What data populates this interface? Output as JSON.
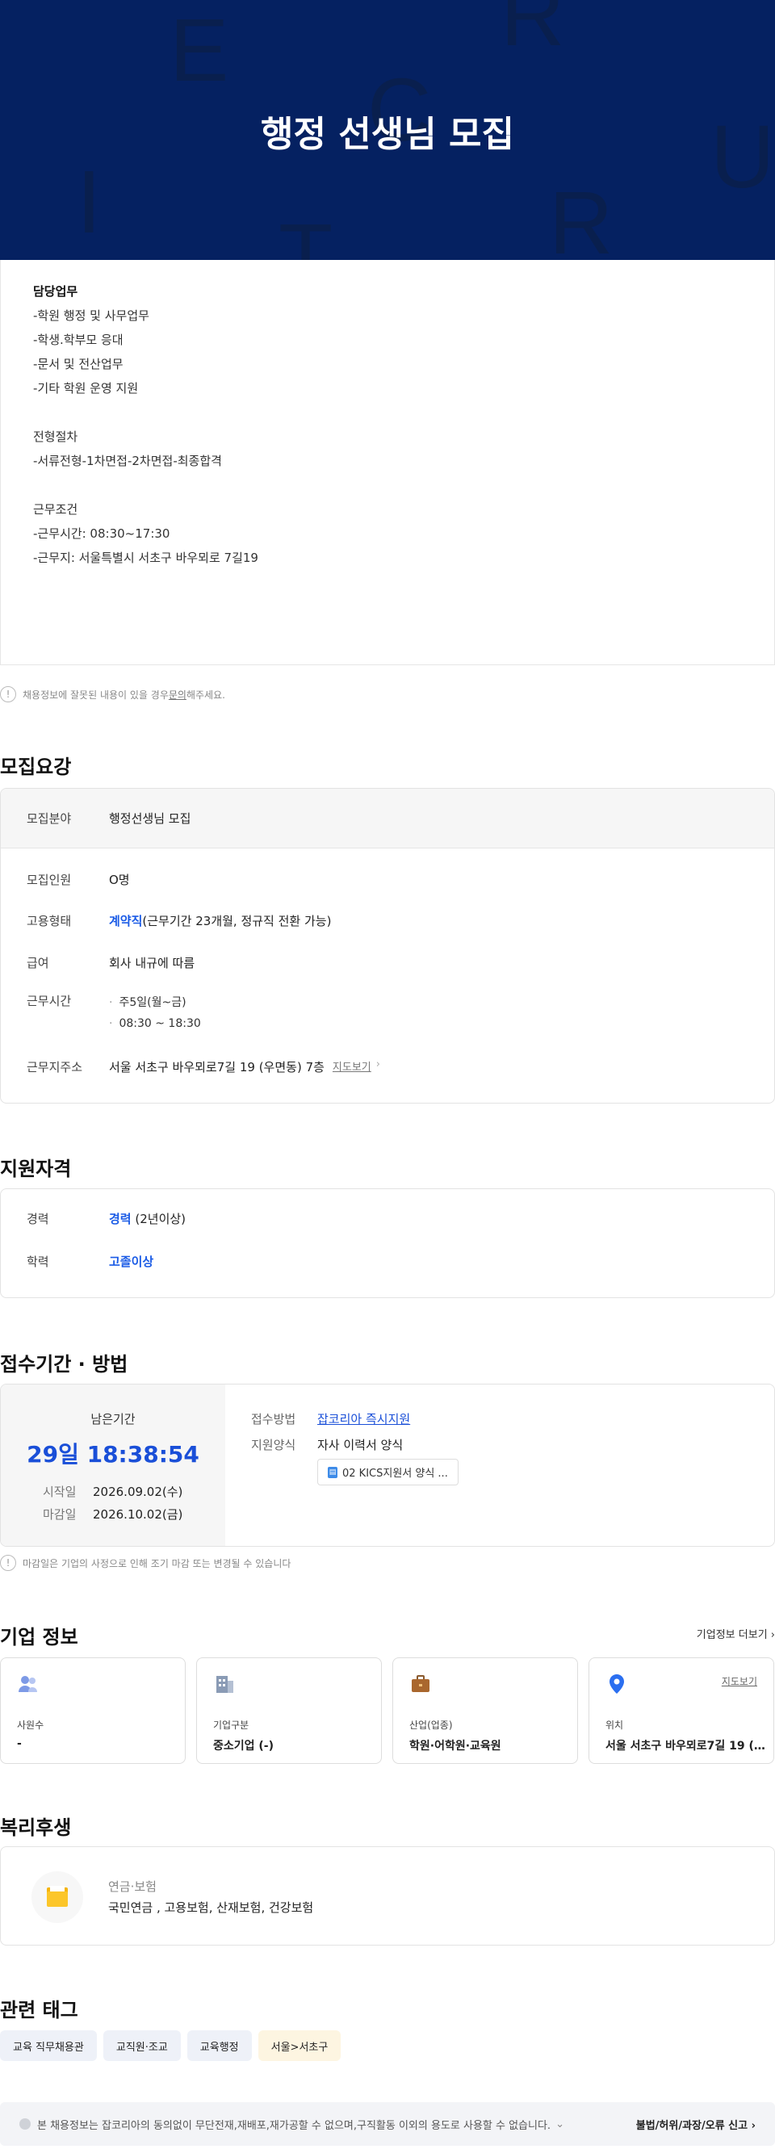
{
  "hero": {
    "title": "행정 선생님 모집"
  },
  "detail": {
    "lines": [
      "담당업무",
      "-학원 행정 및 사무업무",
      "-학생.학부모 응대",
      "-문서 및 전산업무",
      "-기타 학원 운영 지원",
      "",
      "전형절차",
      "-서류전형-1차면접-2차면접-최종합격",
      "",
      "근무조건",
      "-근무시간: 08:30~17:30",
      "-근무지: 서울특별시 서초구 바우뫼로 7길19"
    ]
  },
  "notice1": {
    "text": "채용정보에 잘못된 내용이 있을 경우 ",
    "link": "문의",
    "suffix": "해주세요."
  },
  "recruit": {
    "title": "모집요강",
    "field_label": "모집분야",
    "field_value": "행정선생님 모집",
    "count_label": "모집인원",
    "count_value": "O명",
    "type_label": "고용형태",
    "type_highlight": "계약직",
    "type_detail": "(근무기간 23개월, 정규직 전환 가능)",
    "salary_label": "급여",
    "salary_value": "회사 내규에 따름",
    "hours_label": "근무시간",
    "hours_items": [
      "주5일(월~금)",
      "08:30 ~ 18:30"
    ],
    "address_label": "근무지주소",
    "address_value": "서울 서초구 바우뫼로7길 19 (우면동) 7층",
    "map_link": "지도보기"
  },
  "qualification": {
    "title": "지원자격",
    "career_label": "경력",
    "career_highlight": "경력",
    "career_detail": " (2년이상)",
    "edu_label": "학력",
    "edu_value": "고졸이상"
  },
  "apply": {
    "title": "접수기간 · 방법",
    "remain_label": "남은기간",
    "remain_time": "29일 18:38:54",
    "start_label": "시작일",
    "start_value": "2026.09.02(수)",
    "end_label": "마감일",
    "end_value": "2026.10.02(금)",
    "method_label": "접수방법",
    "method_value": "잡코리아 즉시지원",
    "form_label": "지원양식",
    "form_value": "자사 이력서 양식",
    "file_name": "02 KICS지원서 양식 ..."
  },
  "notice2": {
    "text": "마감일은 기업의 사정으로 인해 조기 마감 또는 변경될 수 있습니다"
  },
  "company": {
    "title": "기업 정보",
    "more_link": "기업정보 더보기",
    "cards": [
      {
        "label": "사원수",
        "value": "-",
        "icon": "people-icon"
      },
      {
        "label": "기업구분",
        "value": "중소기업 (-)",
        "icon": "building-icon"
      },
      {
        "label": "산업(업종)",
        "value": "학원·어학원·교육원",
        "icon": "briefcase-icon"
      },
      {
        "label": "위치",
        "value": "서울 서초구 바우뫼로7길 19 (우...",
        "icon": "location-pin-icon",
        "map": "지도보기"
      }
    ]
  },
  "welfare": {
    "title": "복리후생",
    "category": "연금·보험",
    "value": "국민연금 , 고용보험, 산재보험, 건강보험"
  },
  "tags": {
    "title": "관련 태그",
    "items": [
      "교육 직무채용관",
      "교직원·조교",
      "교육행정",
      "서울>서초구"
    ]
  },
  "footer": {
    "text": "본 채용정보는 잡코리아의 동의없이 무단전재,재배포,재가공할 수 없으며,구직활동 이외의 용도로 사용할 수 없습니다.",
    "report": "불법/허위/과장/오류 신고"
  },
  "colors": {
    "hero_bg": "#052161",
    "accent_blue": "#1a5be6",
    "remain_blue": "#1a4fd8"
  }
}
